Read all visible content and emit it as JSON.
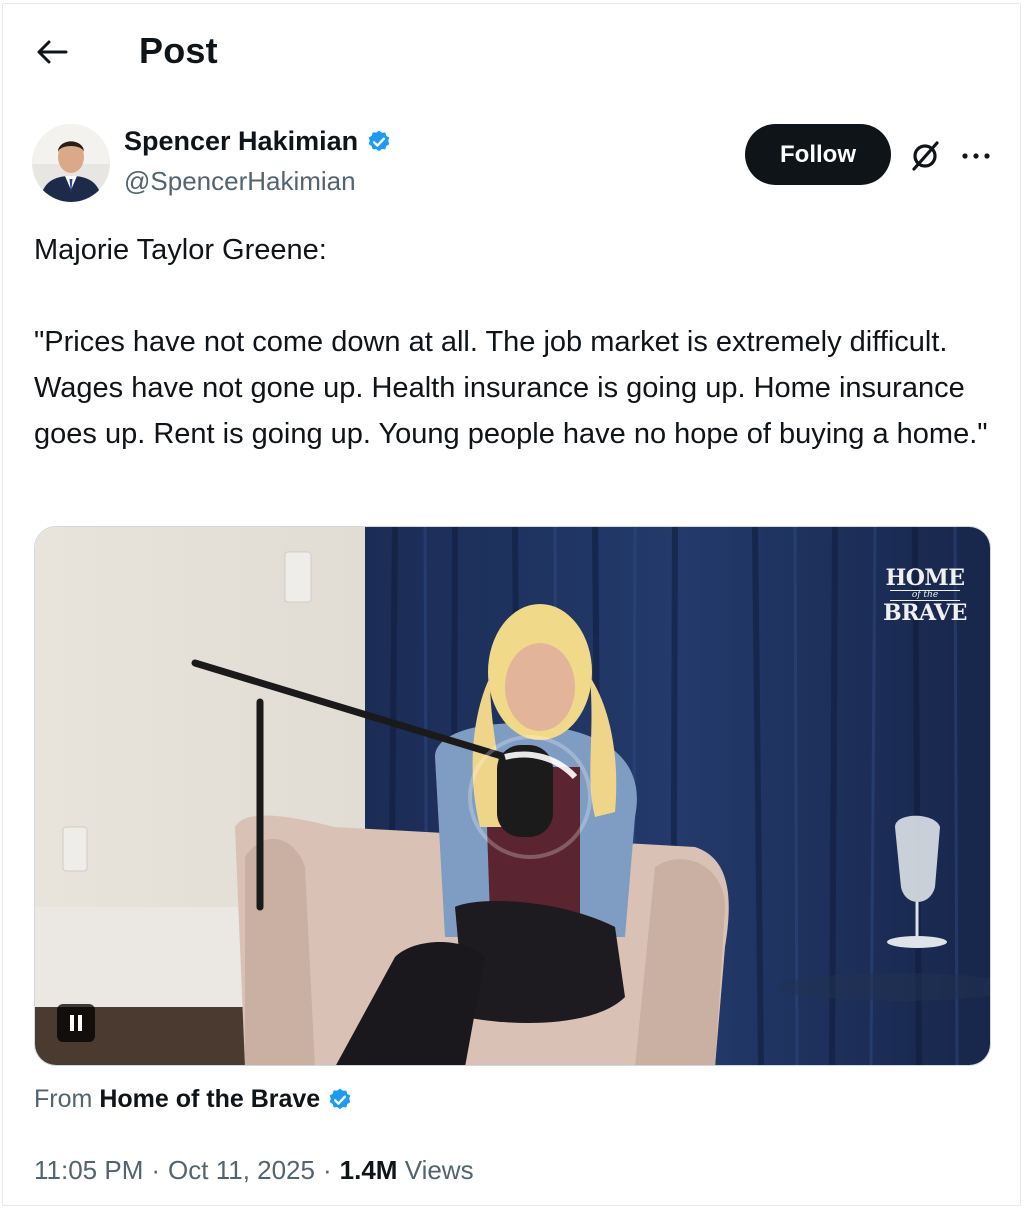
{
  "header": {
    "title": "Post",
    "back_icon": "arrow-left-icon"
  },
  "author": {
    "name": "Spencer Hakimian",
    "handle": "@SpencerHakimian",
    "verified_color": "#1d9bf0"
  },
  "actions": {
    "follow_label": "Follow",
    "grok_icon": "grok-icon",
    "more_icon": "more-icon"
  },
  "post": {
    "line1": "Majorie Taylor Greene:",
    "quote": "\"Prices have not come down at all. The job market is extremely difficult. Wages have not gone up. Health insurance is going up. Home insurance goes up. Rent is going up. Young people have no hope of buying a home.\""
  },
  "media": {
    "watermark_top": "HOME",
    "watermark_mid": "of the",
    "watermark_bottom": "BRAVE",
    "control_icon": "pause-icon"
  },
  "source": {
    "prefix": "From",
    "name": "Home of the Brave"
  },
  "meta": {
    "time": "11:05 PM",
    "sep1": "·",
    "date": "Oct 11, 2025",
    "sep2": "·",
    "views_count": "1.4M",
    "views_label": "Views"
  },
  "colors": {
    "text": "#0f1419",
    "secondary": "#536471",
    "accent": "#1d9bf0"
  }
}
